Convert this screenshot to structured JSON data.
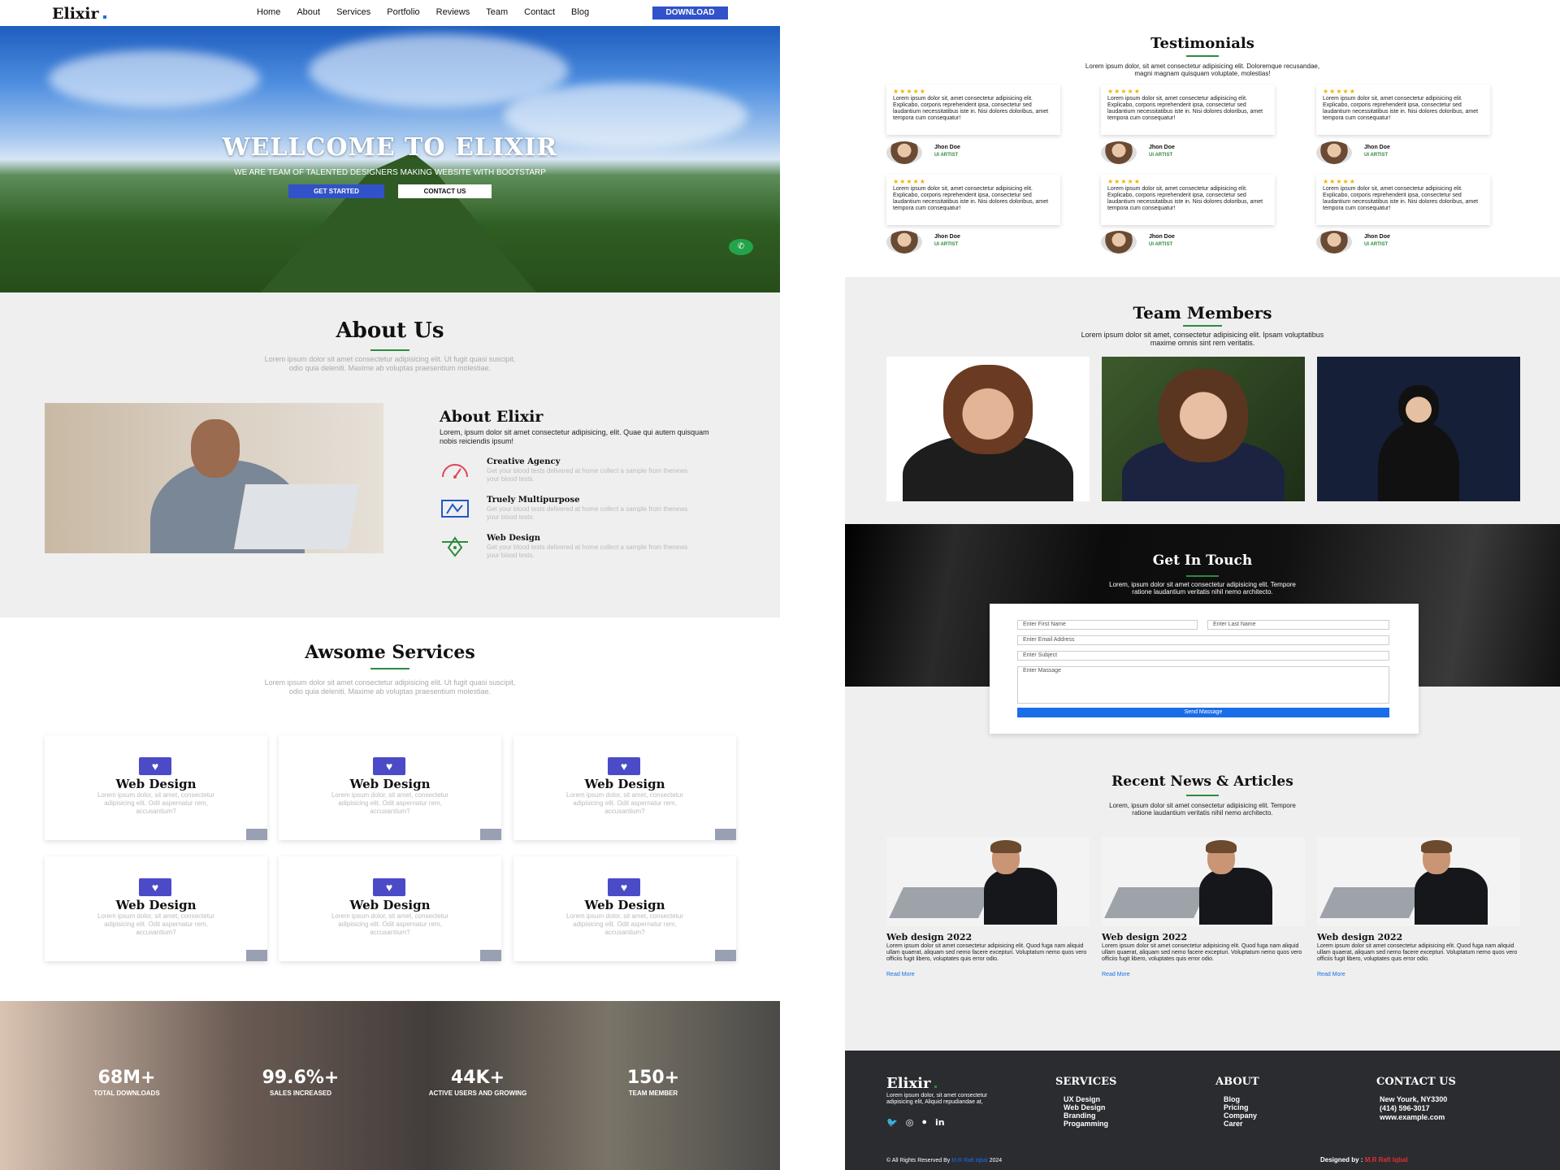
{
  "header": {
    "logo": "Elixir",
    "menu": [
      "Home",
      "About",
      "Services",
      "Portfolio",
      "Reviews",
      "Team",
      "Contact",
      "Blog"
    ],
    "download": "DOWNLOAD"
  },
  "hero": {
    "title": "WELLCOME TO ELIXIR",
    "subtitle": "WE ARE TEAM OF TALENTED DESIGNERS MAKING WEBSITE WITH BOOTSTARP",
    "get_started": "GET STARTED",
    "contact_us": "CONTACT US"
  },
  "about": {
    "title": "About Us",
    "desc_1": "Lorem ipsum dolor sit amet consectetur adipisicing elit. Ut fugit quasi suscipit,",
    "desc_2": "odio quia deleniti. Maxime ab voluptas praesentium molestiae.",
    "elixir_title": "About Elixir",
    "elixir_desc": "Lorem, ipsum dolor sit amet consectetur adipisicing, elit. Quae qui autem quisquam nobis reiciendis ipsum!",
    "features": [
      {
        "title": "Creative Agency",
        "desc": "Get your blood tests delivered at home collect a sample from thenews your blood tests."
      },
      {
        "title": "Truely Multipurpose",
        "desc": "Get your blood tests delivered at home collect a sample from thenews your blood tests."
      },
      {
        "title": "Web Design",
        "desc": "Get your blood tests delivered at home collect a sample from thenews your blood tests."
      }
    ]
  },
  "services": {
    "title": "Awsome Services",
    "desc_1": "Lorem ipsum dolor sit amet consectetur adipisicing elit. Ut fugit quasi suscipit,",
    "desc_2": "odio quia deleniti. Maxime ab voluptas praesentium molestiae.",
    "cards": [
      {
        "title": "Web Design",
        "desc": "Lorem ipsum dolor, sit amet, consectetur adipisicing elit. Odit aspernatur rem, accusantium?"
      },
      {
        "title": "Web Design",
        "desc": "Lorem ipsum dolor, sit amet, consectetur adipisicing elit. Odit aspernatur rem, accusantium?"
      },
      {
        "title": "Web Design",
        "desc": "Lorem ipsum dolor, sit amet, consectetur adipisicing elit. Odit aspernatur rem, accusantium?"
      },
      {
        "title": "Web Design",
        "desc": "Lorem ipsum dolor, sit amet, consectetur adipisicing elit. Odit aspernatur rem, accusantium?"
      },
      {
        "title": "Web Design",
        "desc": "Lorem ipsum dolor, sit amet, consectetur adipisicing elit. Odit aspernatur rem, accusantium?"
      },
      {
        "title": "Web Design",
        "desc": "Lorem ipsum dolor, sit amet, consectetur adipisicing elit. Odit aspernatur rem, accusantium?"
      }
    ]
  },
  "stats": [
    {
      "value": "68M+",
      "label": "TOTAL DOWNLOADS"
    },
    {
      "value": "99.6%+",
      "label": "SALES INCREASED"
    },
    {
      "value": "44K+",
      "label": "ACTIVE USERS AND GROWING"
    },
    {
      "value": "150+",
      "label": "TEAM MEMBER"
    }
  ],
  "testimonials": {
    "title": "Testimonials",
    "desc_1": "Lorem ipsum dolor, sit amet consectetur adipisicing elit. Doloremque recusandae,",
    "desc_2": "magni magnam quisquam voluptate, molestias!",
    "stars": "★★★★★",
    "text": "Lorem ipsum dolor sit, amet consectetur adipisicing elit. Explicabo, corporis reprehenderit ipsa, consectetur sed laudantium necessitatibus iste in. Nisi dolores doloribus, amet tempora cum consequatur!",
    "name": "Jhon Doe",
    "role": "UI ARTIST"
  },
  "team": {
    "title": "Team Members",
    "desc_1": "Lorem ipsum dolor sit amet, consectetur adipisicing elit. Ipsam voluptatibus",
    "desc_2": "maxime omnis sint rem veritatis."
  },
  "contact": {
    "title": "Get In Touch",
    "desc_1": "Lorem, ipsum dolor sit amet consectetur adipisicing elit. Tempore",
    "desc_2": "ratione laudantium veritatis nihil nemo architecto.",
    "first_name": "Enter First Name",
    "last_name": "Enter Last Name",
    "email": "Enter Email Address",
    "subject": "Enter Subject",
    "message": "Enter Massage",
    "send": "Send Massage"
  },
  "news": {
    "title": "Recent News & Articles",
    "desc_1": "Lorem, ipsum dolor sit amet consectetur adipisicing elit. Tempore",
    "desc_2": "ratione laudantium veritatis nihil nemo architecto.",
    "card_title": "Web design 2022",
    "card_desc": "Lorem ipsum dolor sit amet consectetur adipisicing elit. Quod fuga nam aliquid ullam quaerat, aliquam sed nemo facere excepturi. Voluptatum nemo quos vero officiis fugit libero, voluptates quis error odio.",
    "read_more": "Read More"
  },
  "footer": {
    "logo": "Elixir",
    "desc": "Lorem ipsum dolor, sit amet consectetur adipisicing elit, Aliquid repudiandae at,",
    "services_h": "SERVICES",
    "services": [
      "UX Design",
      "Web Design",
      "Branding",
      "Progamming"
    ],
    "about_h": "ABOUT",
    "about": [
      "Blog",
      "Pricing",
      "Company",
      "Carer"
    ],
    "contact_h": "CONTACT US",
    "contact": [
      "New Yourk, NY3300",
      "(414) 596-3017",
      "www.example.com"
    ],
    "copy_pre": "© All Rights Reserved By",
    "copy_name": "M.R Rafi Iqbal",
    "copy_year": "2024",
    "designed_pre": "Designed by :",
    "designed_name": "M.R Rafi Iqbal"
  }
}
